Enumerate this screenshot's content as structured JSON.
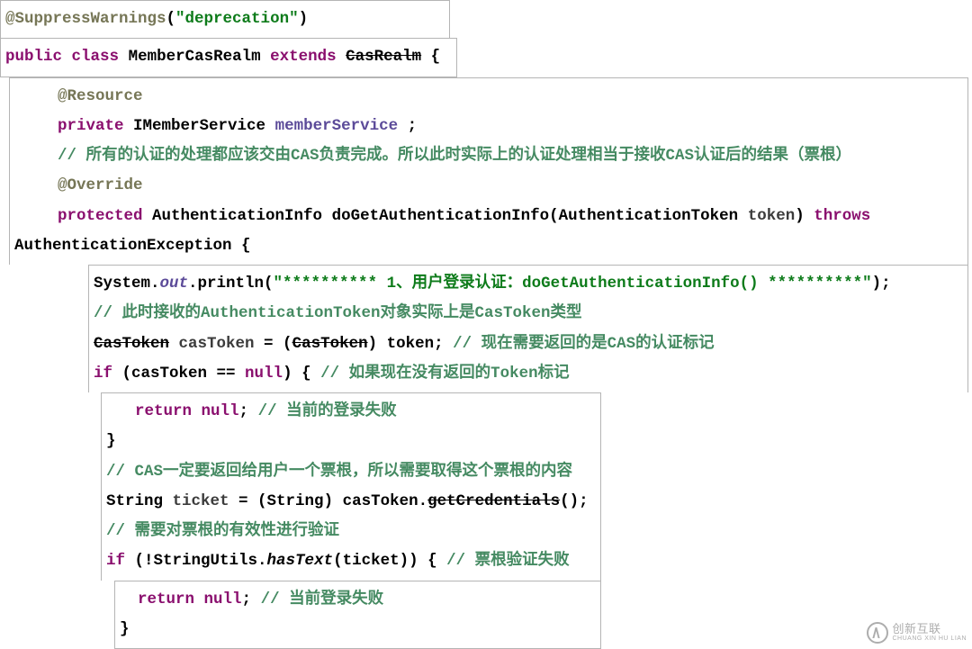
{
  "line1": {
    "annotation": "@SuppressWarnings",
    "paren_open": "(",
    "str": "\"deprecation\"",
    "paren_close": ")"
  },
  "line2": {
    "kw_public": "public",
    "kw_class": "class",
    "class_name": "MemberCasRealm",
    "kw_extends": "extends",
    "parent": "CasRealm",
    "brace": "{"
  },
  "block_a": {
    "resource": "@Resource",
    "kw_private": "private",
    "type": "IMemberService",
    "field": "memberService",
    "semi": " ;",
    "comment1": "// 所有的认证的处理都应该交由CAS负责完成。所以此时实际上的认证处理相当于接收CAS认证后的结果（票根）",
    "override": "@Override",
    "kw_protected": "protected",
    "ret_type": "AuthenticationInfo",
    "method": "doGetAuthenticationInfo",
    "param_type": "AuthenticationToken",
    "param_name": "token",
    "kw_throws": "throws",
    "exc": "AuthenticationException {"
  },
  "block_b": {
    "sysout_pre": "System.",
    "out": "out",
    "println": ".println(",
    "msg": "\"********** 1、用户登录认证：doGetAuthenticationInfo() **********\"",
    "close": ");",
    "comment2": "// 此时接收的AuthenticationToken对象实际上是CasToken类型",
    "castoken_type": "CasToken",
    "var_cas": "casToken",
    "eq": " = (",
    "cast_type": "CasToken",
    "cast_close": ") token;",
    "comment3": " // 现在需要返回的是CAS的认证标记",
    "if_kw": "if",
    "cond_open": " (casToken == ",
    "null_kw": "null",
    "cond_close": ") {",
    "comment4": " // 如果现在没有返回的Token标记"
  },
  "block_c": {
    "ret_kw": "return",
    "null_kw": "null",
    "semi": ";",
    "comment5": " // 当前的登录失败",
    "brace_close": "}",
    "comment6": "// CAS一定要返回给用户一个票根，所以需要取得这个票根的内容",
    "string_type": "String",
    "ticket": "ticket",
    "eq2": " = (String) casToken.",
    "getcred": "getCredentials",
    "paren_end": "();",
    "comment7": "// 需要对票根的有效性进行验证",
    "if2": "if",
    "cond2": " (!StringUtils.",
    "hastext": "hasText",
    "cond2b": "(ticket)) {",
    "comment8": " // 票根验证失败"
  },
  "block_d": {
    "ret_kw2": "return",
    "null_kw2": "null",
    "semi2": ";",
    "comment9": " // 当前登录失败",
    "brace_close2": "}"
  },
  "watermark": {
    "brand": "创新互联",
    "sub": "CHUANG XIN HU LIAN"
  }
}
